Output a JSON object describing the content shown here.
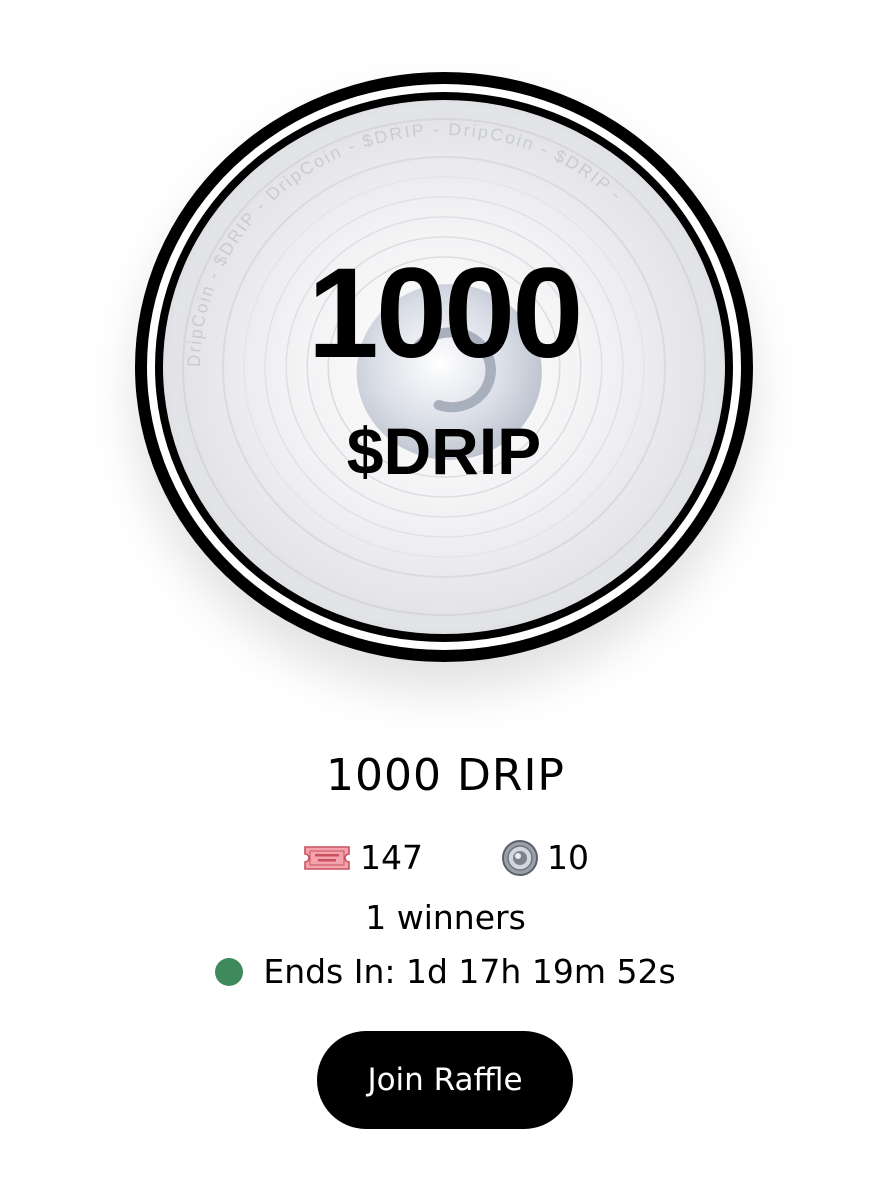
{
  "prize_image": {
    "amount_text": "1000",
    "ticker_text": "$DRIP",
    "rim_text": "DripCoin - $DRIP - DripCoin - $DRIP - DripCoin - $DRIP - ",
    "icon": "dripcoin-image"
  },
  "raffle": {
    "title": "1000 DRIP",
    "tickets_count": "147",
    "ticket_price": "10",
    "winners_text": "1 winners",
    "ends_in_text": "Ends In: 1d 17h 19m 52s",
    "status_color": "#3f8a5b"
  },
  "icons": {
    "tickets": "admit-one-ticket-icon",
    "price": "dripcoin-icon",
    "status": "green-dot-icon"
  },
  "actions": {
    "join_label": "Join Raffle"
  },
  "colors": {
    "button_bg": "#000000",
    "button_text": "#ffffff",
    "ring": "#000000"
  }
}
